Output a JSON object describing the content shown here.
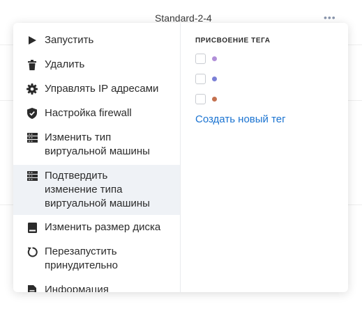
{
  "background": {
    "column_title": "Standard-2-4",
    "more_glyph": "•••"
  },
  "actions": [
    {
      "label": "Запустить",
      "icon": "play-icon"
    },
    {
      "label": "Удалить",
      "icon": "trash-icon"
    },
    {
      "label": "Управлять IP адресами",
      "icon": "gear-icon"
    },
    {
      "label": "Настройка firewall",
      "icon": "shield-check-icon"
    },
    {
      "label": "Изменить тип\nвиртуальной машины",
      "icon": "server-icon"
    },
    {
      "label": "Подтвердить\nизменение типа\nвиртуальной машины",
      "icon": "server-icon",
      "active": true
    },
    {
      "label": "Изменить размер диска",
      "icon": "disk-icon"
    },
    {
      "label": "Перезапустить\nпринудительно",
      "icon": "restart-icon"
    },
    {
      "label": "Информация",
      "icon": "document-icon"
    }
  ],
  "tags": {
    "title": "ПРИСВОЕНИЕ ТЕГА",
    "items": [
      {
        "color": "#b18fd8",
        "checked": false
      },
      {
        "color": "#7b80d6",
        "checked": false
      },
      {
        "color": "#c4714f",
        "checked": false
      }
    ],
    "create_label": "Создать новый тег"
  },
  "colors": {
    "accent": "#1a73d1",
    "active_row": "#eff2f6",
    "text": "#2b2b2b"
  }
}
